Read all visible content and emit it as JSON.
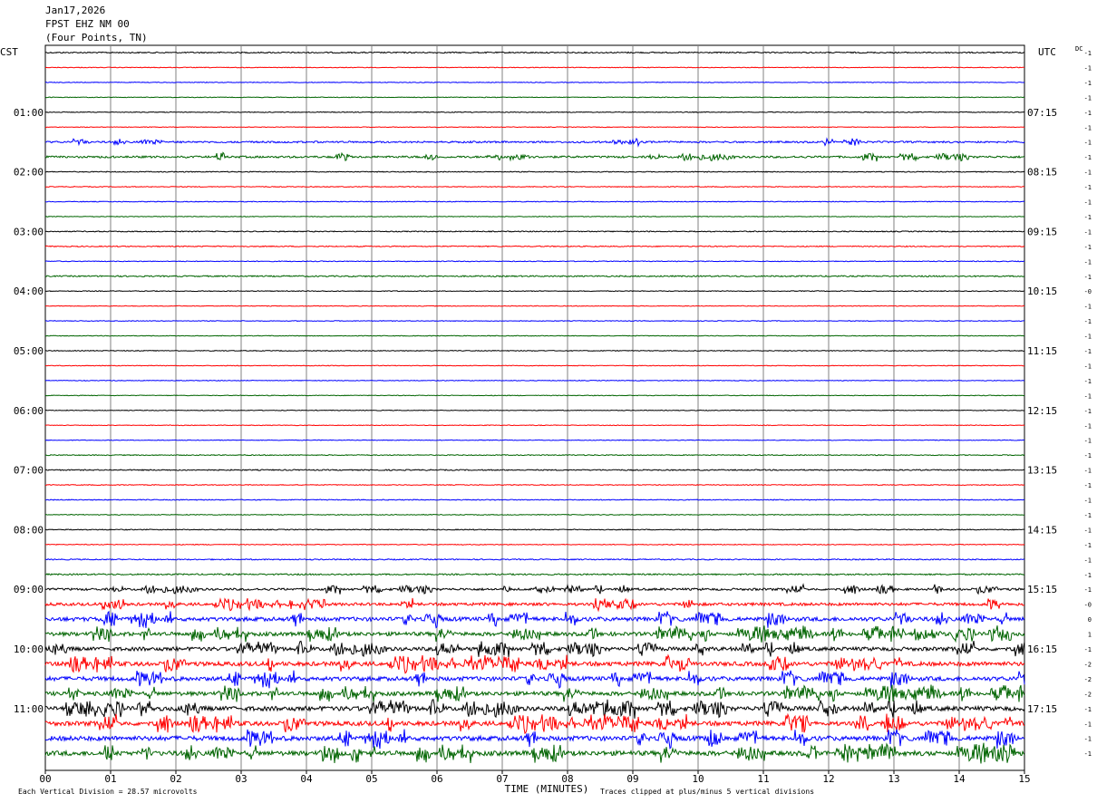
{
  "header": {
    "date": "Jan17,2026",
    "station": "FPST EHZ NM 00",
    "location": "(Four Points, TN)"
  },
  "left_zone_label": "CST",
  "right_zone_label": "UTC",
  "dc_label": "DC",
  "footer": {
    "scale_text": "Each Vertical Division =   28.57 microvolts",
    "xlabel": "TIME (MINUTES)",
    "clip_text": "Traces clipped at plus/minus 5 vertical divisions"
  },
  "colors": {
    "black": "#000000",
    "red": "#ff0000",
    "blue": "#0000ff",
    "green": "#006400",
    "grid": "#808080"
  },
  "chart_data": {
    "type": "line",
    "title": "FPST EHZ NM 00 (Four Points, TN) Jan17,2026",
    "xlabel": "TIME (MINUTES)",
    "xlim": [
      0,
      15
    ],
    "x_ticks": [
      "00",
      "01",
      "02",
      "03",
      "04",
      "05",
      "06",
      "07",
      "08",
      "09",
      "10",
      "11",
      "12",
      "13",
      "14",
      "15"
    ],
    "trace_minutes": 15,
    "trace_count": 48,
    "trace_color_cycle": [
      "black",
      "red",
      "blue",
      "green"
    ],
    "left_time_labels": [
      {
        "trace": 4,
        "label": "01:00"
      },
      {
        "trace": 8,
        "label": "02:00"
      },
      {
        "trace": 12,
        "label": "03:00"
      },
      {
        "trace": 16,
        "label": "04:00"
      },
      {
        "trace": 20,
        "label": "05:00"
      },
      {
        "trace": 24,
        "label": "06:00"
      },
      {
        "trace": 28,
        "label": "07:00"
      },
      {
        "trace": 32,
        "label": "08:00"
      },
      {
        "trace": 36,
        "label": "09:00"
      },
      {
        "trace": 40,
        "label": "10:00"
      },
      {
        "trace": 44,
        "label": "11:00"
      }
    ],
    "right_time_labels": [
      {
        "trace": 4,
        "label": "07:15"
      },
      {
        "trace": 8,
        "label": "08:15"
      },
      {
        "trace": 12,
        "label": "09:15"
      },
      {
        "trace": 16,
        "label": "10:15"
      },
      {
        "trace": 20,
        "label": "11:15"
      },
      {
        "trace": 24,
        "label": "12:15"
      },
      {
        "trace": 28,
        "label": "13:15"
      },
      {
        "trace": 32,
        "label": "14:15"
      },
      {
        "trace": 36,
        "label": "15:15"
      },
      {
        "trace": 40,
        "label": "16:15"
      },
      {
        "trace": 44,
        "label": "17:15"
      }
    ],
    "dc_offsets": [
      "-1",
      "-1",
      "-1",
      "-1",
      "-1",
      "-1",
      "-1",
      "-1",
      "-1",
      "-1",
      "-1",
      "-1",
      "-1",
      "-1",
      "-1",
      "-1",
      "-0",
      "-1",
      "-1",
      "-1",
      "-1",
      "-1",
      "-1",
      "-1",
      "-1",
      "-1",
      "-1",
      "-1",
      "-1",
      "-1",
      "-1",
      "-1",
      "-1",
      "-1",
      "-1",
      "-1",
      "-1",
      "-0",
      "0",
      "1",
      "-1",
      "-2",
      "-2",
      "-2",
      "-1",
      "-1",
      "-1",
      "-1"
    ],
    "activity_level": [
      1.1,
      0.6,
      0.6,
      0.6,
      0.7,
      0.6,
      1.6,
      1.8,
      0.8,
      0.7,
      0.7,
      0.6,
      0.9,
      0.9,
      0.7,
      1.2,
      0.7,
      0.6,
      0.6,
      0.6,
      0.7,
      0.6,
      0.6,
      0.6,
      0.6,
      0.6,
      0.6,
      0.8,
      1.0,
      0.7,
      0.8,
      0.7,
      0.8,
      0.7,
      1.0,
      1.3,
      2.0,
      2.6,
      3.6,
      3.4,
      3.4,
      3.8,
      3.8,
      3.6,
      4.0,
      4.0,
      4.2,
      4.2
    ]
  }
}
